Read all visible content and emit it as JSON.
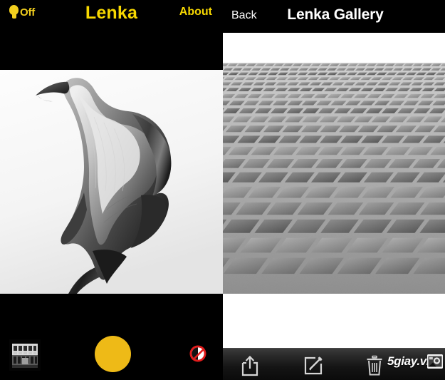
{
  "camera": {
    "header": {
      "flash_icon": "lightbulb-icon",
      "flash_label": "Off",
      "title": "Lenka",
      "about_label": "About"
    },
    "photo": {
      "alt": "black-and-white calla lily flower photograph",
      "background": "#f3f3f3"
    },
    "controls": {
      "thumbnail_icon": "photo-thumbnail-building",
      "shutter_icon": "shutter-button",
      "shutter_color": "#eeba17",
      "noflash_icon": "no-flash-icon",
      "noflash_color": "#e11b1b"
    }
  },
  "gallery": {
    "header": {
      "back_label": "Back",
      "title": "Lenka Gallery"
    },
    "photo": {
      "alt": "black-and-white cobblestone tile pavement in perspective"
    },
    "toolbar": {
      "share_icon": "share-icon",
      "edit_icon": "edit-pencil-icon",
      "trash_icon": "trash-icon"
    }
  },
  "watermark": {
    "text": "5giay.vn",
    "icon": "photo-icon"
  },
  "colors": {
    "accent_yellow": "#f7d800",
    "shutter_yellow": "#eeba17",
    "bulb_yellow": "#f2cf1e",
    "alert_red": "#e11b1b",
    "chrome_black": "#000000",
    "panel_white": "#ffffff"
  }
}
